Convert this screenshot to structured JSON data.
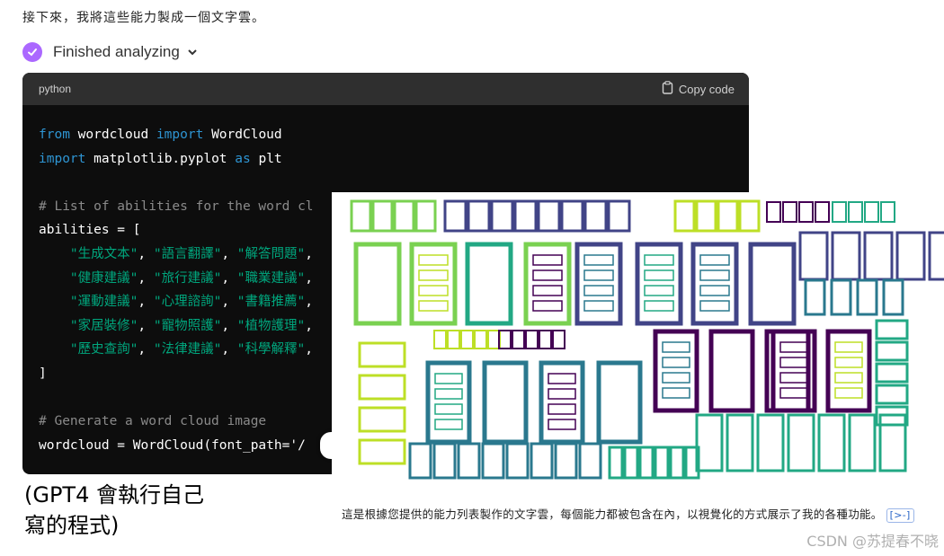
{
  "intro": {
    "text": "接下來，我將這些能力製成一個文字雲。"
  },
  "status": {
    "label": "Finished analyzing",
    "icon": "check-icon",
    "accent": "#ab68ff"
  },
  "code_block": {
    "language": "python",
    "copy_label": "Copy code",
    "lines": [
      [
        {
          "t": "from",
          "c": "kw"
        },
        {
          "t": " wordcloud ",
          "c": ""
        },
        {
          "t": "import",
          "c": "kw"
        },
        {
          "t": " WordCloud",
          "c": ""
        }
      ],
      [
        {
          "t": "import",
          "c": "kw"
        },
        {
          "t": " matplotlib.pyplot ",
          "c": ""
        },
        {
          "t": "as",
          "c": "kw"
        },
        {
          "t": " plt",
          "c": ""
        }
      ],
      [],
      [
        {
          "t": "# List of abilities for the word cl",
          "c": "cm"
        }
      ],
      [
        {
          "t": "abilities = [",
          "c": ""
        }
      ],
      [
        {
          "t": "    ",
          "c": ""
        },
        {
          "t": "\"生成文本\"",
          "c": "str"
        },
        {
          "t": ", ",
          "c": ""
        },
        {
          "t": "\"語言翻譯\"",
          "c": "str"
        },
        {
          "t": ", ",
          "c": ""
        },
        {
          "t": "\"解答問題\"",
          "c": "str"
        },
        {
          "t": ",",
          "c": ""
        }
      ],
      [
        {
          "t": "    ",
          "c": ""
        },
        {
          "t": "\"健康建議\"",
          "c": "str"
        },
        {
          "t": ", ",
          "c": ""
        },
        {
          "t": "\"旅行建議\"",
          "c": "str"
        },
        {
          "t": ", ",
          "c": ""
        },
        {
          "t": "\"職業建議\"",
          "c": "str"
        },
        {
          "t": ",",
          "c": ""
        }
      ],
      [
        {
          "t": "    ",
          "c": ""
        },
        {
          "t": "\"運動建議\"",
          "c": "str"
        },
        {
          "t": ", ",
          "c": ""
        },
        {
          "t": "\"心理諮詢\"",
          "c": "str"
        },
        {
          "t": ", ",
          "c": ""
        },
        {
          "t": "\"書籍推薦\"",
          "c": "str"
        },
        {
          "t": ",",
          "c": ""
        }
      ],
      [
        {
          "t": "    ",
          "c": ""
        },
        {
          "t": "\"家居裝修\"",
          "c": "str"
        },
        {
          "t": ", ",
          "c": ""
        },
        {
          "t": "\"寵物照護\"",
          "c": "str"
        },
        {
          "t": ", ",
          "c": ""
        },
        {
          "t": "\"植物護理\"",
          "c": "str"
        },
        {
          "t": ",",
          "c": ""
        }
      ],
      [
        {
          "t": "    ",
          "c": ""
        },
        {
          "t": "\"歷史查詢\"",
          "c": "str"
        },
        {
          "t": ", ",
          "c": ""
        },
        {
          "t": "\"法律建議\"",
          "c": "str"
        },
        {
          "t": ", ",
          "c": ""
        },
        {
          "t": "\"科學解釋\"",
          "c": "str"
        },
        {
          "t": ",",
          "c": ""
        }
      ],
      [
        {
          "t": "]",
          "c": ""
        }
      ],
      [],
      [
        {
          "t": "# Generate a word cloud image",
          "c": "cm"
        }
      ],
      [
        {
          "t": "wordcloud = WordCloud(font_path='/",
          "c": ""
        }
      ]
    ]
  },
  "caption": {
    "line1": "(GPT4 會執行自己",
    "line2": "寫的程式)"
  },
  "wordcloud_panel": {
    "description": "這是根據您提供的能力列表製作的文字雲，每個能力都被包含在內，以視覺化的方式展示了我的各種功能。",
    "citation": "[>-]",
    "colors": [
      "#7ad151",
      "#414487",
      "#2a788e",
      "#22a884",
      "#440154",
      "#bddf26"
    ]
  },
  "watermark": {
    "text": "CSDN @苏提春不晓"
  }
}
